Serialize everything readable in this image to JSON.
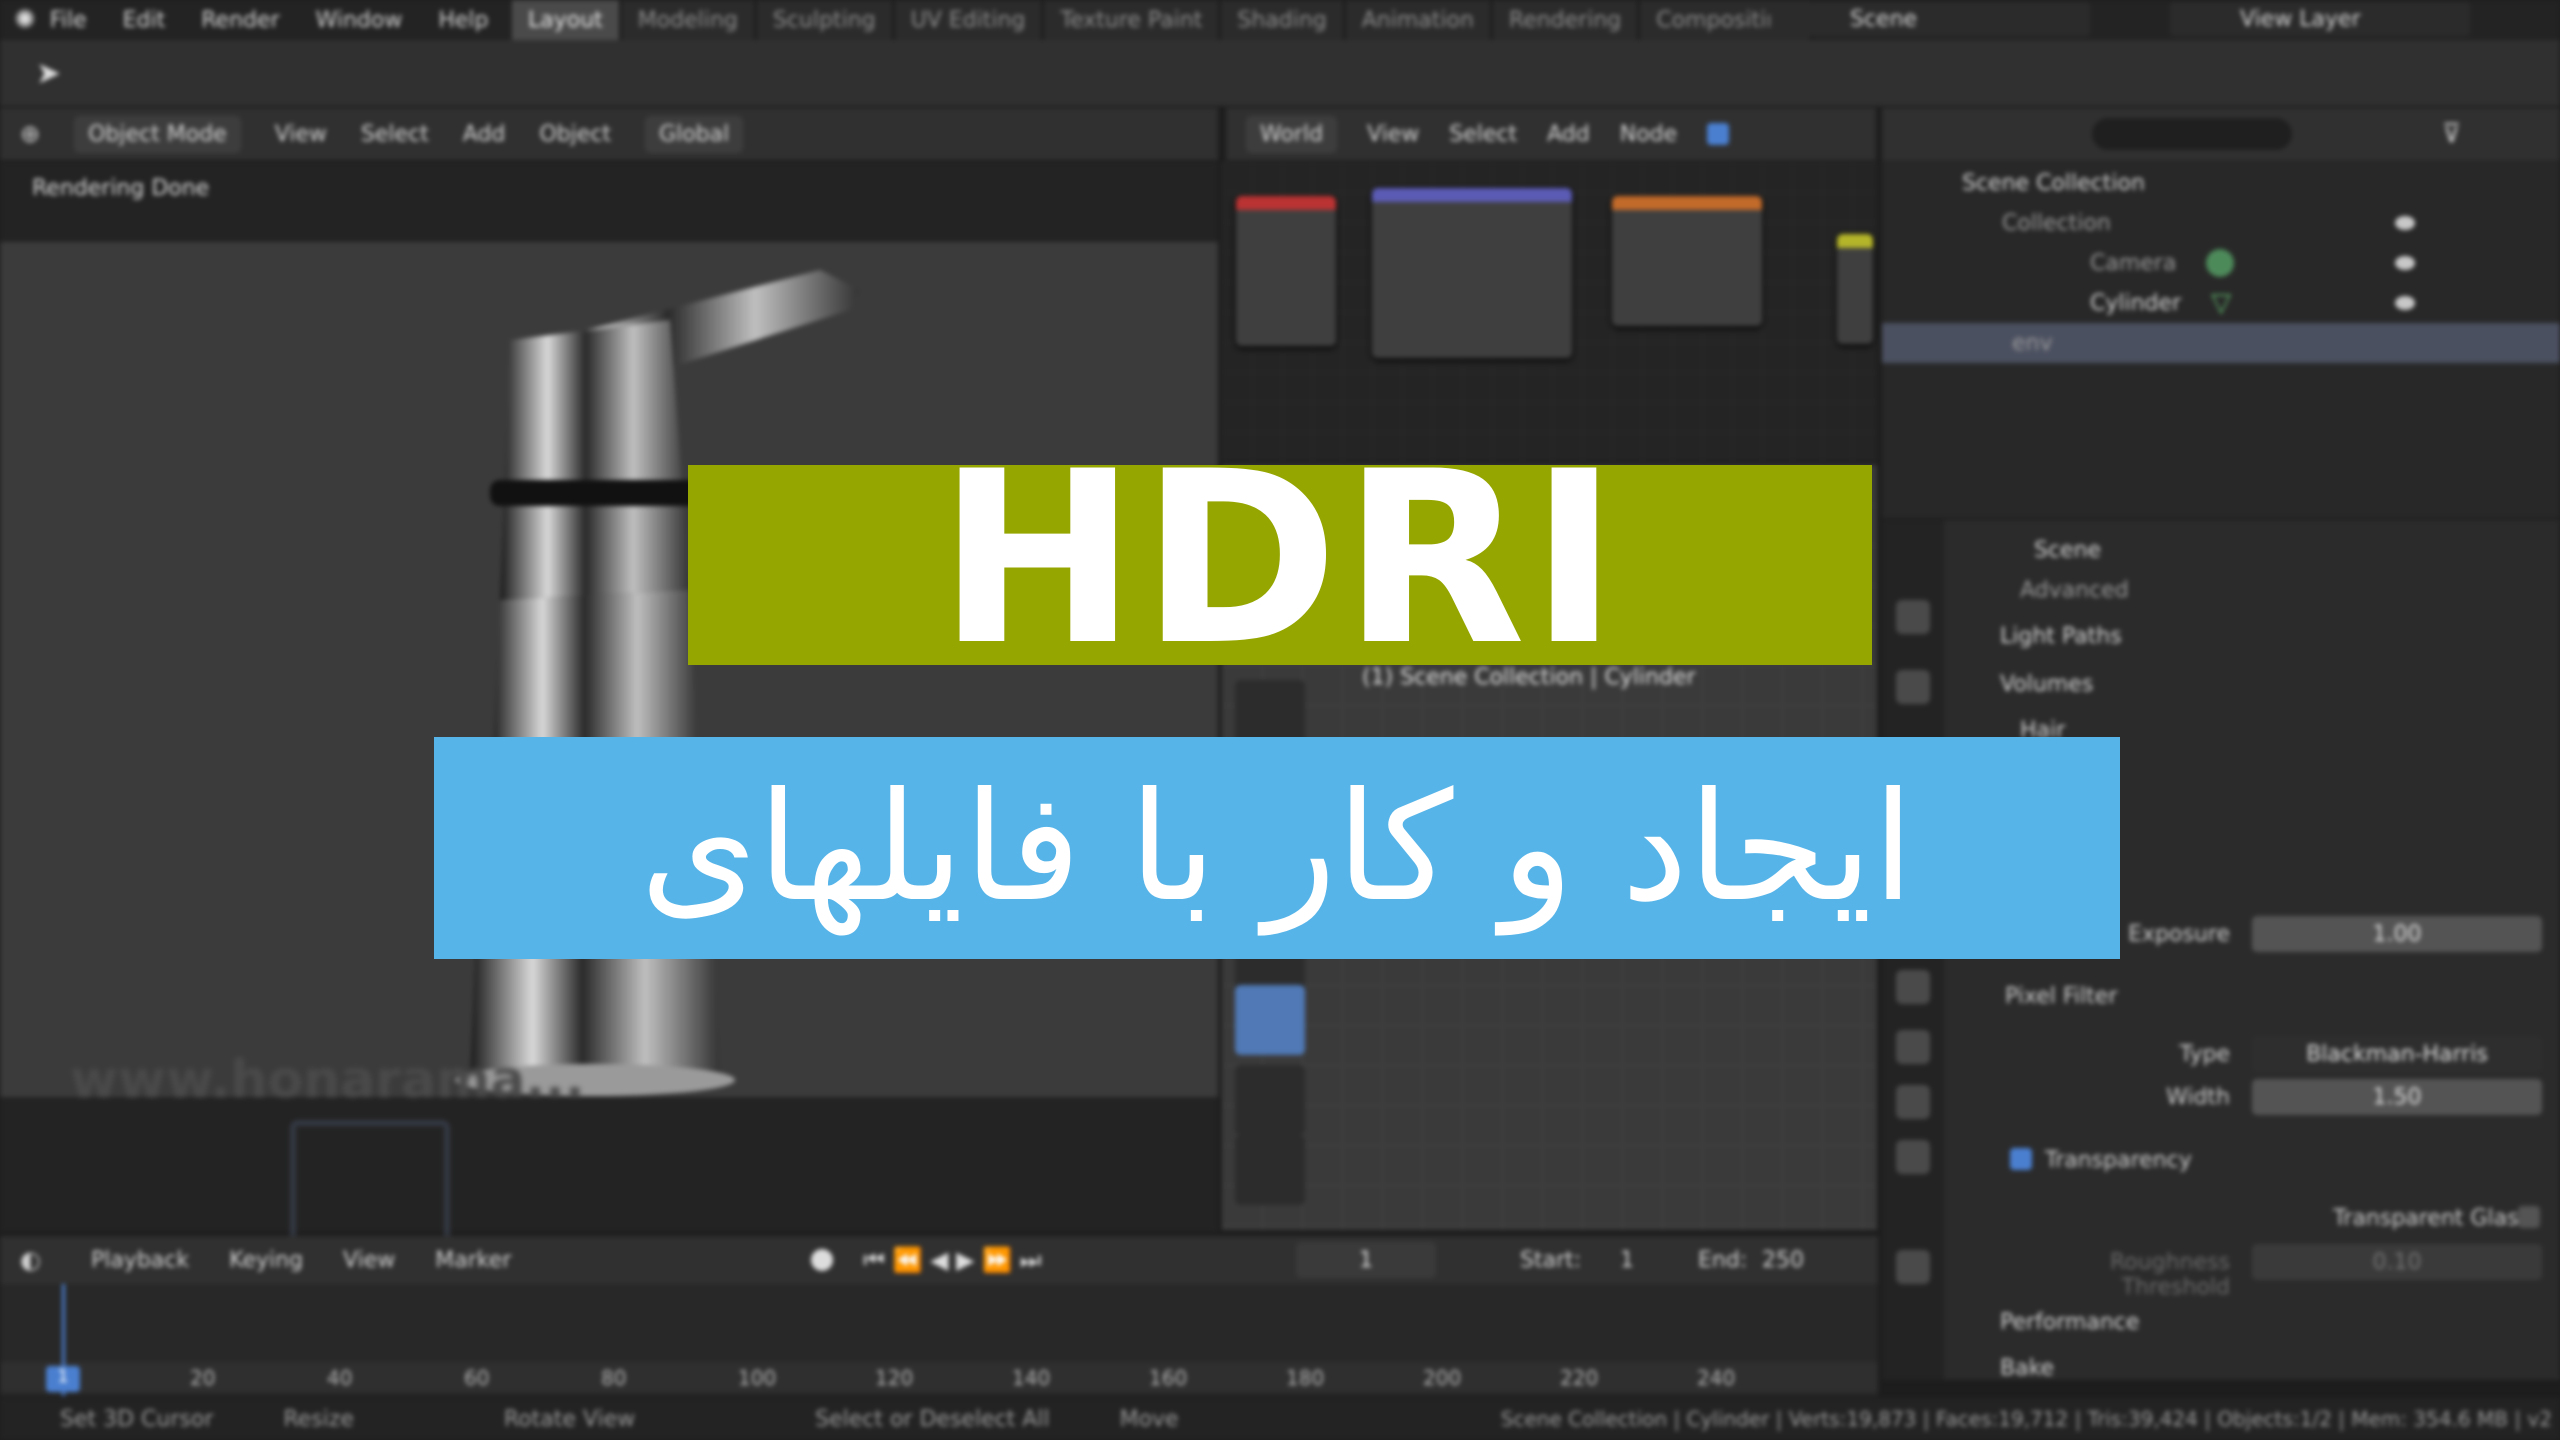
{
  "menu": {
    "items": [
      "File",
      "Edit",
      "Render",
      "Window",
      "Help"
    ]
  },
  "workspaces": {
    "tabs": [
      "Layout",
      "Modeling",
      "Sculpting",
      "UV Editing",
      "Texture Paint",
      "Shading",
      "Animation",
      "Rendering",
      "Compositing"
    ],
    "active": "Layout"
  },
  "scene": {
    "label": "Scene"
  },
  "view_layer": {
    "label": "View Layer"
  },
  "viewport_header": {
    "mode": "Object Mode",
    "items": [
      "View",
      "Select",
      "Add",
      "Object"
    ],
    "orientation": "Global"
  },
  "node_header": {
    "world": "World",
    "items": [
      "View",
      "Select",
      "Add",
      "Node"
    ]
  },
  "viewport": {
    "status": "Rendering Done",
    "overlay_text": "(1) Scene Collection | Cylinder"
  },
  "watermark": {
    "text": "www.honarama..."
  },
  "outliner": {
    "root": "Scene Collection",
    "rows": [
      {
        "label": "Collection"
      },
      {
        "label": "Camera"
      },
      {
        "label": "Cylinder"
      },
      {
        "label": "env"
      }
    ]
  },
  "properties": {
    "context": "Scene",
    "sections": [
      "Advanced",
      "Light Paths",
      "Volumes",
      "Hair"
    ],
    "exposure_label": "Exposure",
    "exposure_value": "1.00",
    "pixel_filter": "Pixel Filter",
    "type_label": "Type",
    "type_value": "Blackman-Harris",
    "width_label": "Width",
    "width_value": "1.50",
    "transparency": "Transparency",
    "transparent_glass": "Transparent Glass",
    "roughness_label": "Roughness Threshold",
    "roughness_value": "0.10",
    "performance": "Performance",
    "bake": "Bake"
  },
  "timeline": {
    "items": [
      "Playback",
      "Keying",
      "View",
      "Marker"
    ],
    "current_frame": "1",
    "start_label": "Start:",
    "start": "1",
    "end_label": "End:",
    "end": "250",
    "ticks": [
      "20",
      "40",
      "60",
      "80",
      "100",
      "120",
      "140",
      "160",
      "180",
      "200",
      "220",
      "240"
    ],
    "playhead": "1"
  },
  "statusbar": {
    "hints": [
      "Set 3D Cursor",
      "Resize",
      "Rotate View",
      "Select or Deselect All",
      "Move"
    ],
    "stats": "Scene Collection | Cylinder | Verts:19,873 | Faces:19,712 | Tris:39,424 | Objects:1/2 | Mem: 354.6 MB | v2"
  },
  "overlay": {
    "title": "HDRI",
    "subtitle": "ایجاد و کار با فایلهای",
    "green": "#95a600",
    "blue": "#56b4e9"
  }
}
